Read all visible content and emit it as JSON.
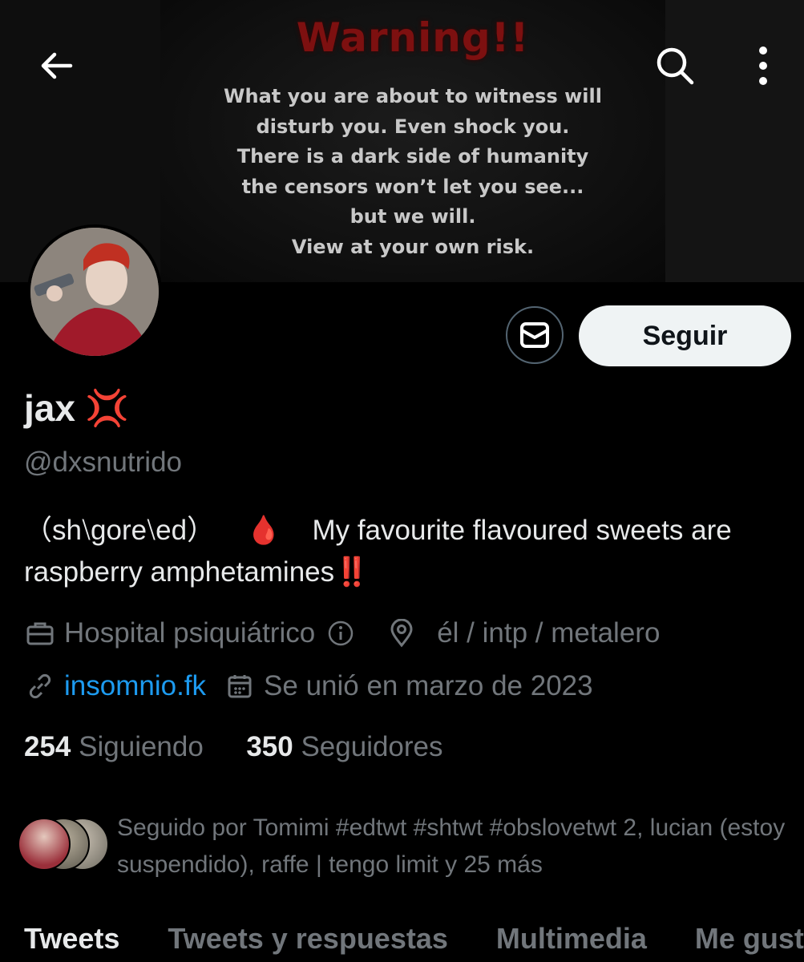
{
  "banner": {
    "title": "Warning!!",
    "text": "What you are about to witness will\ndisturb you. Even shock you.\nThere is a dark side of humanity\nthe censors won’t let you see...\nbut we will.\nView at your own risk."
  },
  "header": {
    "back_icon": "arrow-left-icon",
    "search_icon": "search-icon",
    "more_icon": "more-vertical-icon"
  },
  "profile": {
    "name": "jax",
    "name_emoji": "💢",
    "handle": "@dxsnutrido",
    "bio": "（sh⧵gore⧵ed）    🩸    My favourite flavoured sweets are raspberry amphetamines‼️",
    "follow_label": "Seguir",
    "message_icon": "envelope-icon",
    "professional_category": "Hospital psiquiátrico",
    "location": "él / intp / metalero",
    "website": "insomnio.fk",
    "joined": "Se unió en marzo de 2023",
    "following_count": "254",
    "following_label": "Siguiendo",
    "followers_count": "350",
    "followers_label": "Seguidores",
    "followed_by": "Seguido por Tomimi #edtwt #shtwt #obslovetwt 2, lucian (estoy suspendido), raffe | tengo limit y 25 más"
  },
  "tabs": [
    {
      "label": "Tweets",
      "active": true
    },
    {
      "label": "Tweets y respuestas",
      "active": false
    },
    {
      "label": "Multimedia",
      "active": false
    },
    {
      "label": "Me gusta",
      "active": false
    }
  ],
  "colors": {
    "background": "#000000",
    "text": "#e7e9ea",
    "secondary_text": "#71767b",
    "link": "#1d9bf0",
    "follow_button": "#eff3f4",
    "banner_title": "#7d1010"
  }
}
